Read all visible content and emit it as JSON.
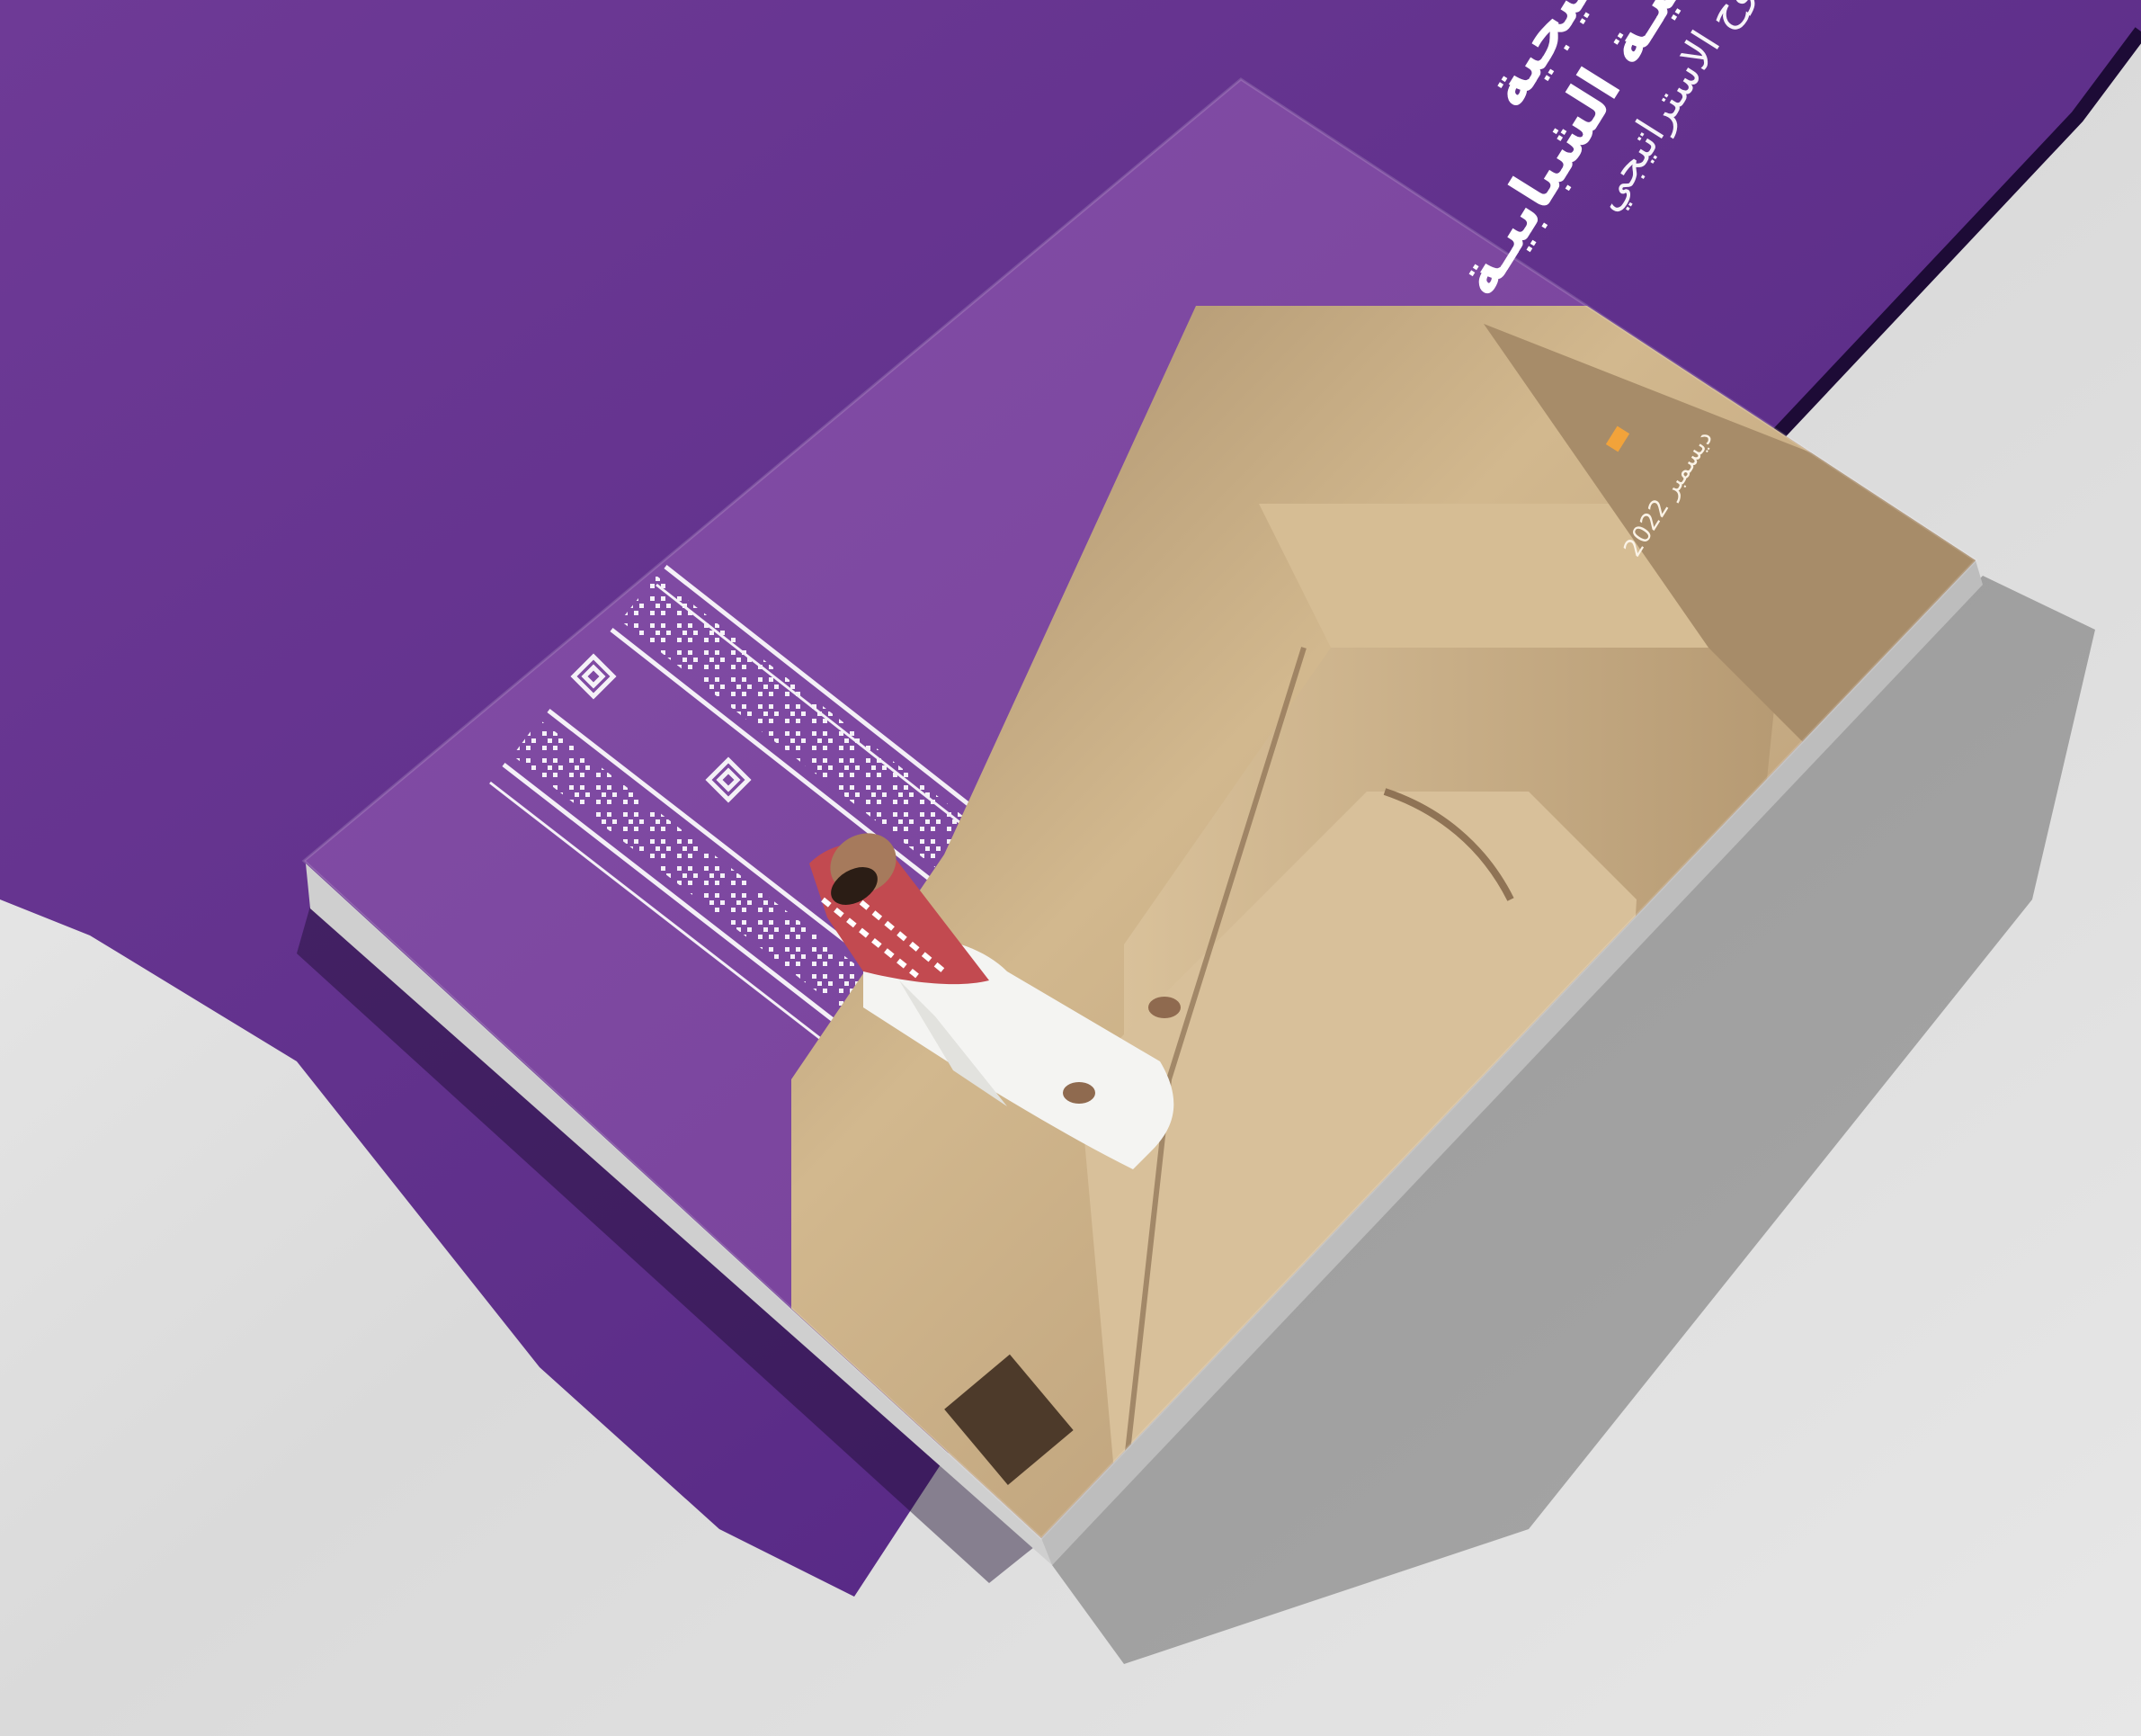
{
  "cover": {
    "title_line_1": "استراتيجية",
    "title_line_2": "التنميـة الشبابيـة",
    "subtitle": "الطموح الاستراتيجي",
    "date": "ديسمبر 2022"
  },
  "colors": {
    "purple": "#6a3a93",
    "purple_dark": "#4b1f78",
    "purple_light": "#8a52a9",
    "mud_wall": "#cfb489",
    "accent_orange": "#f2a33a",
    "background": "#e0e0e0"
  }
}
